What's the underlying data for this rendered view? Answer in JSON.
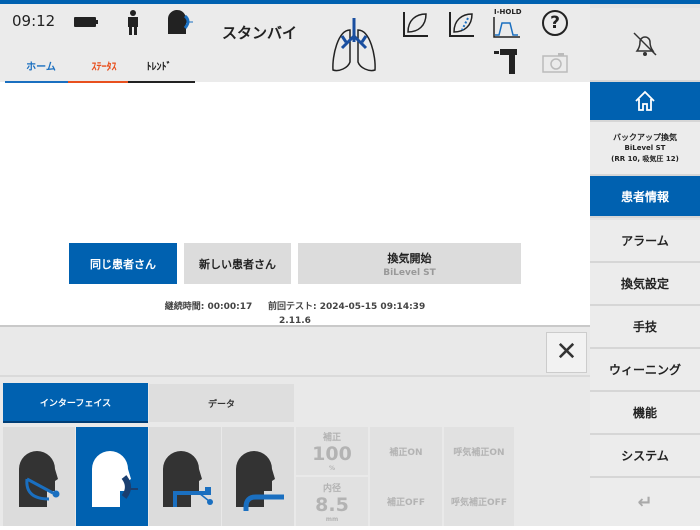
{
  "header": {
    "time": "09:12",
    "status": "スタンバイ",
    "ihold_label": "I-HOLD",
    "tabs": [
      {
        "label": "ホーム",
        "color": "#1a6fc0"
      },
      {
        "label": "ｽﾃｰﾀｽ",
        "color": "#e8501e"
      },
      {
        "label": "ﾄﾚﾝﾄﾞ",
        "color": "#222222"
      }
    ],
    "icons": [
      "battery-icon",
      "patient-adult-icon",
      "mask-icon",
      "lungs-icon",
      "loop-icon",
      "loop-dynamic-icon",
      "i-hold-icon",
      "help-icon",
      "tube-icon",
      "camera-icon"
    ]
  },
  "main": {
    "buttons": {
      "same_patient": "同じ患者さん",
      "new_patient": "新しい患者さん",
      "start_vent": "換気開始",
      "start_vent_mode": "BiLevel ST"
    },
    "duration_label": "継続時間:",
    "duration": "00:00:17",
    "last_test_label": "前回テスト:",
    "last_test": "2024-05-15 09:14:39",
    "version": "2.11.6"
  },
  "panel": {
    "tabs": [
      "インターフェイス",
      "データ"
    ],
    "interfaces": [
      "oronasal-mask",
      "nasal-mask",
      "tracheostomy",
      "endotracheal-tube"
    ],
    "comp_label": "補正",
    "comp_value": "100",
    "comp_unit": "%",
    "diam_label": "内径",
    "diam_value": "8.5",
    "diam_unit": "mm",
    "comp_on": "補正ON",
    "comp_off": "補正OFF",
    "exp_comp_on": "呼気補正ON",
    "exp_comp_off": "呼気補正OFF"
  },
  "sidebar": {
    "backup_title": "バックアップ換気",
    "backup_mode": "BiLevel ST",
    "backup_params": "(RR 10, 吸気圧 12)",
    "items": [
      "患者情報",
      "アラーム",
      "換気設定",
      "手技",
      "ウィーニング",
      "機能",
      "システム"
    ]
  },
  "colors": {
    "accent": "#0061b0"
  }
}
